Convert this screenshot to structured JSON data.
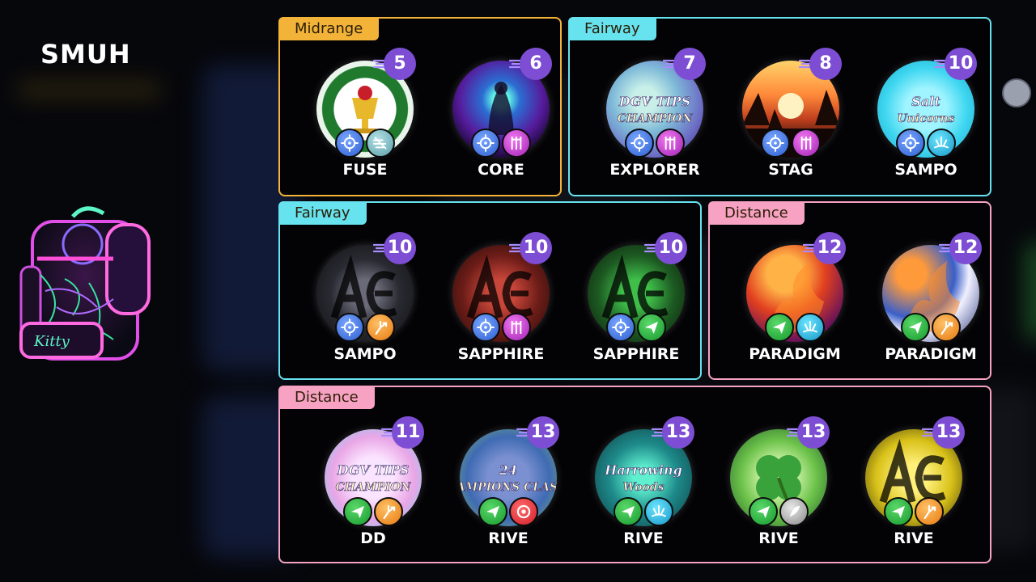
{
  "player": {
    "name": "SMUH"
  },
  "colors": {
    "midrange": "#f3b338",
    "fairway": "#67e2ef",
    "distance": "#f7a2c2",
    "speed_badge": "#7d4ed4"
  },
  "panels": [
    {
      "category": "Midrange",
      "discs": [
        {
          "name": "FUSE",
          "speed": "5",
          "badges": [
            "target-icon",
            "wind-icon"
          ]
        },
        {
          "name": "CORE",
          "speed": "6",
          "badges": [
            "target-icon",
            "chain-icon"
          ]
        }
      ]
    },
    {
      "category": "Fairway",
      "discs": [
        {
          "name": "EXPLORER",
          "speed": "7",
          "badges": [
            "target-icon",
            "chain-icon"
          ],
          "art_text": [
            "DGV TIPS",
            "CHAMPION"
          ]
        },
        {
          "name": "STAG",
          "speed": "8",
          "badges": [
            "target-icon",
            "chain-icon"
          ]
        },
        {
          "name": "SAMPO",
          "speed": "10",
          "badges": [
            "target-icon",
            "splash-icon"
          ],
          "art_text": [
            "Salt",
            "Unicorns"
          ]
        }
      ]
    },
    {
      "category": "Fairway",
      "discs": [
        {
          "name": "SAMPO",
          "speed": "10",
          "badges": [
            "target-icon",
            "split-arrow-icon"
          ]
        },
        {
          "name": "SAPPHIRE",
          "speed": "10",
          "badges": [
            "target-icon",
            "chain-icon"
          ]
        },
        {
          "name": "SAPPHIRE",
          "speed": "10",
          "badges": [
            "target-icon",
            "paper-plane-icon"
          ]
        }
      ]
    },
    {
      "category": "Distance",
      "discs": [
        {
          "name": "PARADIGM",
          "speed": "12",
          "badges": [
            "paper-plane-icon",
            "splash-icon"
          ]
        },
        {
          "name": "PARADIGM",
          "speed": "12",
          "badges": [
            "paper-plane-icon",
            "split-arrow-icon"
          ]
        }
      ]
    },
    {
      "category": "Distance",
      "discs": [
        {
          "name": "DD",
          "speed": "11",
          "badges": [
            "paper-plane-icon",
            "split-arrow-icon"
          ],
          "art_text": [
            "DGV TIPS",
            "CHAMPION"
          ]
        },
        {
          "name": "RIVE",
          "speed": "13",
          "badges": [
            "paper-plane-icon",
            "power-icon"
          ],
          "art_text": [
            "24",
            "CHAMPIONS CLASSIC"
          ]
        },
        {
          "name": "RIVE",
          "speed": "13",
          "badges": [
            "paper-plane-icon",
            "splash-icon"
          ],
          "art_text": [
            "Harrowing",
            "Woods"
          ]
        },
        {
          "name": "RIVE",
          "speed": "13",
          "badges": [
            "paper-plane-icon",
            "feather-icon"
          ]
        },
        {
          "name": "RIVE",
          "speed": "13",
          "badges": [
            "paper-plane-icon",
            "split-arrow-icon"
          ]
        }
      ]
    }
  ]
}
